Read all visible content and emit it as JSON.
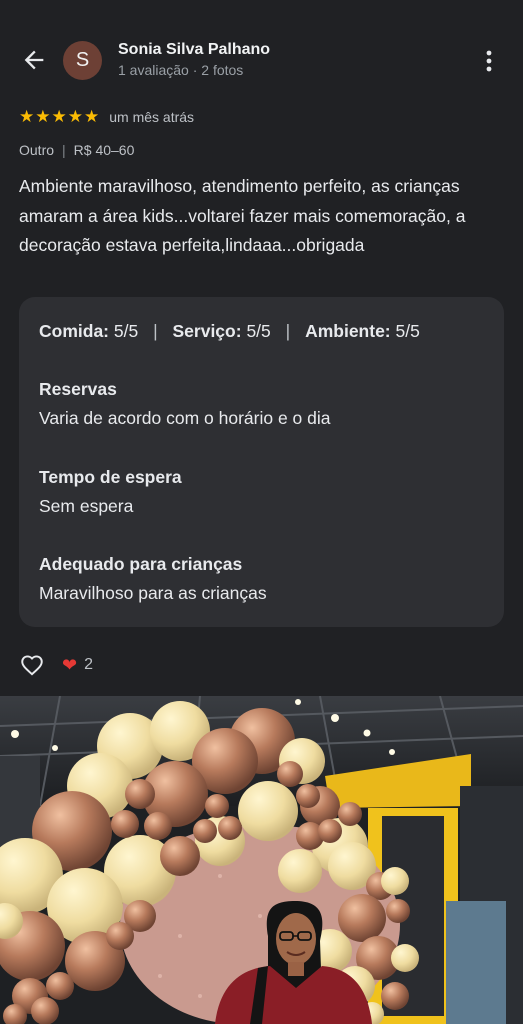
{
  "reviewer": {
    "initial": "S",
    "name": "Sonia Silva Palhano",
    "meta": "1 avaliação · 2 fotos"
  },
  "rating": {
    "stars": 5,
    "max": 5,
    "time_ago": "um mês atrás"
  },
  "tags": {
    "category": "Outro",
    "price": "R$ 40–60"
  },
  "review_text": "Ambiente maravilhoso, atendimento perfeito, as crianças amaram a área kids...voltarei fazer mais comemoração, a decoração estava perfeita,lindaaa...obrigada",
  "scores": {
    "food_label": "Comida:",
    "food_value": "5/5",
    "service_label": "Serviço:",
    "service_value": "5/5",
    "ambience_label": "Ambiente:",
    "ambience_value": "5/5"
  },
  "details": {
    "reservations_title": "Reservas",
    "reservations_value": "Varia de acordo com o horário e o dia",
    "wait_title": "Tempo de espera",
    "wait_value": "Sem espera",
    "kids_title": "Adequado para crianças",
    "kids_value": "Maravilhoso para as crianças"
  },
  "reactions": {
    "heart_count": "2"
  },
  "colors": {
    "background": "#202124",
    "card": "#2e2f33",
    "star": "#fbbc04",
    "heart": "#e53935",
    "avatar": "#6d4035"
  },
  "icons": [
    "back-arrow-icon",
    "more-vert-icon",
    "star-icon",
    "like-heart-outline-icon",
    "heart-reaction-icon"
  ]
}
